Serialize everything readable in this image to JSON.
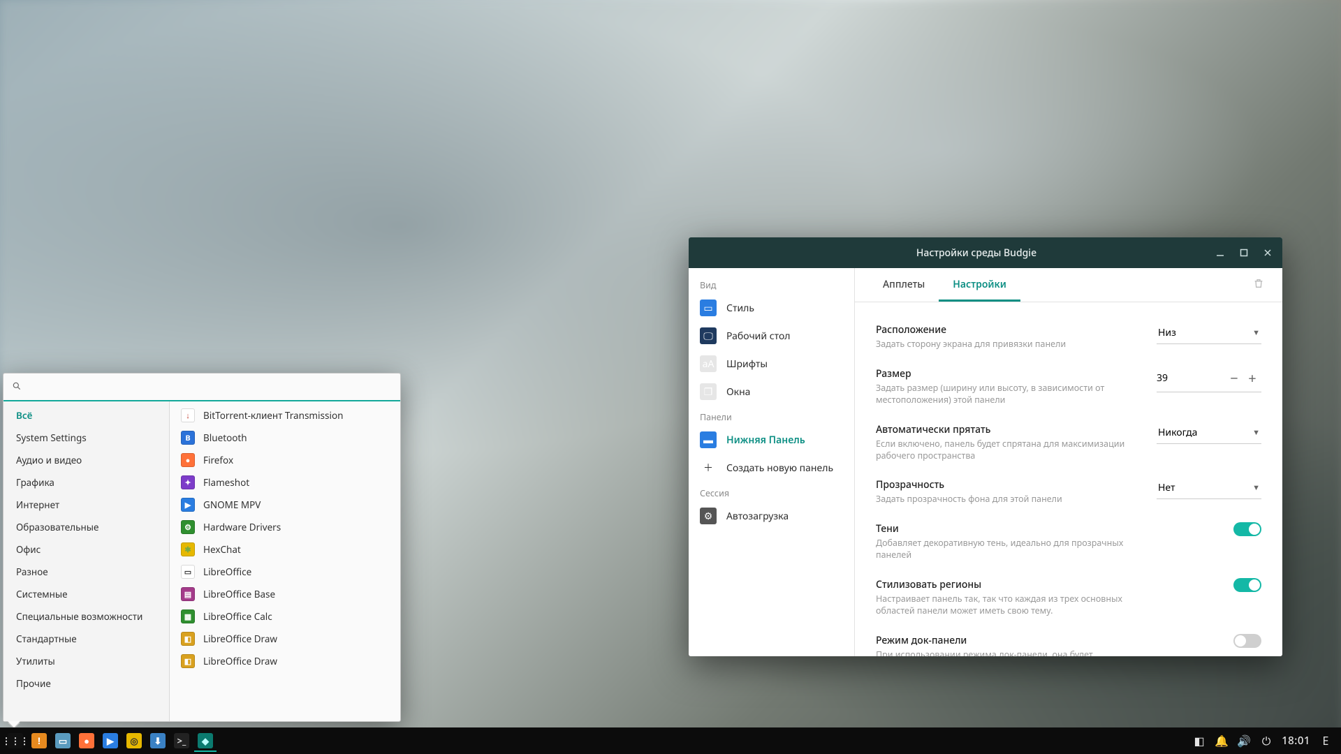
{
  "taskbar": {
    "clock": "18:01",
    "launchers": [
      {
        "name": "apps-icon",
        "bg": "#111",
        "fg": "#eee",
        "glyph": "⋮⋮⋮"
      },
      {
        "name": "notify-icon",
        "bg": "#e68a1f",
        "fg": "#fff",
        "glyph": "!"
      },
      {
        "name": "files-icon",
        "bg": "#5a9bbf",
        "fg": "#fff",
        "glyph": "▭"
      },
      {
        "name": "firefox-icon",
        "bg": "#ff7139",
        "fg": "#fff",
        "glyph": "●"
      },
      {
        "name": "gnomempv-icon",
        "bg": "#2a7de1",
        "fg": "#fff",
        "glyph": "▶"
      },
      {
        "name": "rhythmbox-icon",
        "bg": "#e6b800",
        "fg": "#333",
        "glyph": "◎"
      },
      {
        "name": "software-icon",
        "bg": "#3a81c4",
        "fg": "#fff",
        "glyph": "⬇"
      },
      {
        "name": "terminal-icon",
        "bg": "#222",
        "fg": "#ddd",
        "glyph": ">_"
      },
      {
        "name": "budgie-settings-icon",
        "bg": "#0b7a6f",
        "fg": "#bff",
        "glyph": "◆",
        "active": true
      }
    ],
    "tray": [
      {
        "name": "workspace-icon",
        "glyph": "◧"
      },
      {
        "name": "notification-bell-icon",
        "glyph": "🔔"
      },
      {
        "name": "volume-icon",
        "glyph": "🔊"
      },
      {
        "name": "power-icon",
        "glyph": "⏻"
      }
    ],
    "end_glyph": "E"
  },
  "appmenu": {
    "search_placeholder": "",
    "categories": [
      {
        "label": "Всё",
        "selected": true
      },
      {
        "label": "System Settings"
      },
      {
        "label": "Аудио и видео"
      },
      {
        "label": "Графика"
      },
      {
        "label": "Интернет"
      },
      {
        "label": "Образовательные"
      },
      {
        "label": "Офис"
      },
      {
        "label": "Разное"
      },
      {
        "label": "Системные"
      },
      {
        "label": "Специальные возможности"
      },
      {
        "label": "Стандартные"
      },
      {
        "label": "Утилиты"
      },
      {
        "label": "Прочие"
      }
    ],
    "apps": [
      {
        "label": "BitTorrent-клиент Transmission",
        "bg": "#fff",
        "fg": "#c0392b",
        "glyph": "↓"
      },
      {
        "label": "Bluetooth",
        "bg": "#2b72d9",
        "fg": "#fff",
        "glyph": "B"
      },
      {
        "label": "Firefox",
        "bg": "#ff7139",
        "fg": "#fff",
        "glyph": "●"
      },
      {
        "label": "Flameshot",
        "bg": "#7d3cc9",
        "fg": "#fff",
        "glyph": "✦"
      },
      {
        "label": "GNOME MPV",
        "bg": "#2a7de1",
        "fg": "#fff",
        "glyph": "▶"
      },
      {
        "label": "Hardware Drivers",
        "bg": "#2f8f2f",
        "fg": "#fff",
        "glyph": "⚙"
      },
      {
        "label": "HexChat",
        "bg": "#e6b800",
        "fg": "#7a4",
        "glyph": "✱"
      },
      {
        "label": "LibreOffice",
        "bg": "#fff",
        "fg": "#333",
        "glyph": "▭"
      },
      {
        "label": "LibreOffice Base",
        "bg": "#a43b8a",
        "fg": "#fff",
        "glyph": "▤"
      },
      {
        "label": "LibreOffice Calc",
        "bg": "#2f8f2f",
        "fg": "#fff",
        "glyph": "▦"
      },
      {
        "label": "LibreOffice Draw",
        "bg": "#d9a11f",
        "fg": "#fff",
        "glyph": "◧"
      },
      {
        "label": "LibreOffice Draw",
        "bg": "#d9a11f",
        "fg": "#fff",
        "glyph": "◧"
      }
    ]
  },
  "settings": {
    "title": "Настройки среды Budgie",
    "sidebar": {
      "groups": [
        {
          "label": "Вид",
          "items": [
            {
              "label": "Стиль",
              "bg": "#2a7de1",
              "glyph": "▭"
            },
            {
              "label": "Рабочий стол",
              "bg": "#1f3a5f",
              "glyph": "🖵"
            },
            {
              "label": "Шрифты",
              "bg": "#e6e6e6",
              "glyph": "aA"
            },
            {
              "label": "Окна",
              "bg": "#e6e6e6",
              "glyph": "❐"
            }
          ]
        },
        {
          "label": "Панели",
          "items": [
            {
              "label": "Нижняя Панель",
              "bg": "#2a7de1",
              "glyph": "▬",
              "selected": true
            },
            {
              "label": "Создать новую панель",
              "bg": "transparent",
              "glyph": "＋"
            }
          ]
        },
        {
          "label": "Сессия",
          "items": [
            {
              "label": "Автозагрузка",
              "bg": "#555",
              "glyph": "⚙"
            }
          ]
        }
      ]
    },
    "tabs": [
      {
        "label": "Апплеты"
      },
      {
        "label": "Настройки",
        "selected": true
      }
    ],
    "rows": [
      {
        "key": "position",
        "type": "select",
        "title": "Расположение",
        "desc": "Задать сторону экрана для привязки панели",
        "value": "Низ"
      },
      {
        "key": "size",
        "type": "stepper",
        "title": "Размер",
        "desc": "Задать размер (ширину или высоту, в зависимости от местоположения) этой панели",
        "value": "39"
      },
      {
        "key": "autohide",
        "type": "select",
        "title": "Автоматически прятать",
        "desc": "Если включено, панель будет спрятана для максимизации рабочего пространства",
        "value": "Никогда"
      },
      {
        "key": "transparency",
        "type": "select",
        "title": "Прозрачность",
        "desc": "Задать прозрачность фона для этой панели",
        "value": "Нет"
      },
      {
        "key": "shadows",
        "type": "switch",
        "title": "Тени",
        "desc": "Добавляет декоративную тень, идеально для прозрачных панелей",
        "value": true
      },
      {
        "key": "styleregions",
        "type": "switch",
        "title": "Стилизовать регионы",
        "desc": "Настраивает панель так, так что каждая из трех основных областей панели может иметь свою тему.",
        "value": true
      },
      {
        "key": "dockmode",
        "type": "switch",
        "title": "Режим док-панели",
        "desc": "При использовании режима док-панели, она будет минимизирована, по максимуму освобождая пространство на экране",
        "value": false
      }
    ]
  }
}
